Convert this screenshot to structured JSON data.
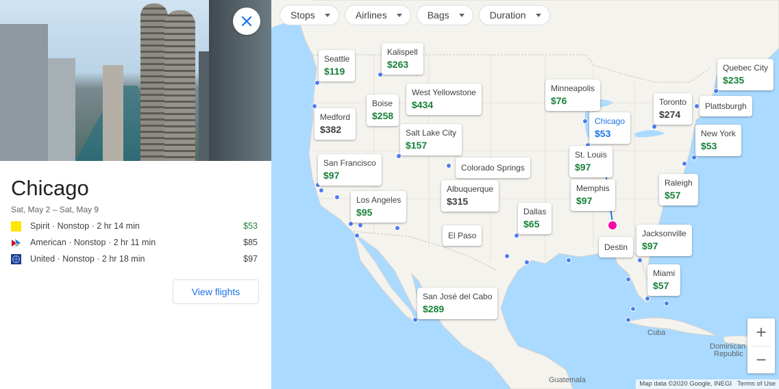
{
  "panel": {
    "city": "Chicago",
    "dates": "Sat, May 2 – Sat, May 9",
    "flights": [
      {
        "airline": "Spirit",
        "stops": "Nonstop",
        "duration": "2 hr 14 min",
        "price": "$53",
        "cheapest": true,
        "logo_color": "#ffe600"
      },
      {
        "airline": "American",
        "stops": "Nonstop",
        "duration": "2 hr 11 min",
        "price": "$85",
        "cheapest": false,
        "logo_color": "#c8102e"
      },
      {
        "airline": "United",
        "stops": "Nonstop",
        "duration": "2 hr 18 min",
        "price": "$97",
        "cheapest": false,
        "logo_color": "#1a3d8f"
      }
    ],
    "separator": " · ",
    "view_flights_label": "View flights"
  },
  "filters": [
    "Stops",
    "Airlines",
    "Bags",
    "Duration"
  ],
  "destinations": [
    {
      "name": "Seattle",
      "price": "$119"
    },
    {
      "name": "Kalispell",
      "price": "$263"
    },
    {
      "name": "West Yellowstone",
      "price": "$434"
    },
    {
      "name": "Boise",
      "price": "$258"
    },
    {
      "name": "Medford",
      "price": "$382"
    },
    {
      "name": "Salt Lake City",
      "price": "$157"
    },
    {
      "name": "San Francisco",
      "price": "$97"
    },
    {
      "name": "Colorado Springs",
      "price": ""
    },
    {
      "name": "Los Angeles",
      "price": "$95"
    },
    {
      "name": "Albuquerque",
      "price": "$315"
    },
    {
      "name": "El Paso",
      "price": ""
    },
    {
      "name": "Dallas",
      "price": "$65"
    },
    {
      "name": "Minneapolis",
      "price": "$76"
    },
    {
      "name": "Chicago",
      "price": "$53"
    },
    {
      "name": "St. Louis",
      "price": "$97"
    },
    {
      "name": "Memphis",
      "price": "$97"
    },
    {
      "name": "Destin",
      "price": ""
    },
    {
      "name": "Toronto",
      "price": "$274"
    },
    {
      "name": "Quebec City",
      "price": "$235"
    },
    {
      "name": "Plattsburgh",
      "price": ""
    },
    {
      "name": "New York",
      "price": "$53"
    },
    {
      "name": "Raleigh",
      "price": "$57"
    },
    {
      "name": "Jacksonville",
      "price": "$97"
    },
    {
      "name": "Miami",
      "price": "$57"
    },
    {
      "name": "San José del Cabo",
      "price": "$289"
    }
  ],
  "map_labels": {
    "cuba": "Cuba",
    "dominican": "Dominican",
    "republic": "Republic",
    "guatemala": "Guatemala"
  },
  "attribution": {
    "data": "Map data ©2020 Google, INEGI",
    "terms": "Terms of Use"
  },
  "zoom": {
    "in": "+",
    "out": "−"
  },
  "colors": {
    "accent": "#1a73e8",
    "price_green": "#188038",
    "origin_pin": "#f50aa5",
    "dot_blue": "#4c7df0",
    "water": "#aadaff"
  }
}
